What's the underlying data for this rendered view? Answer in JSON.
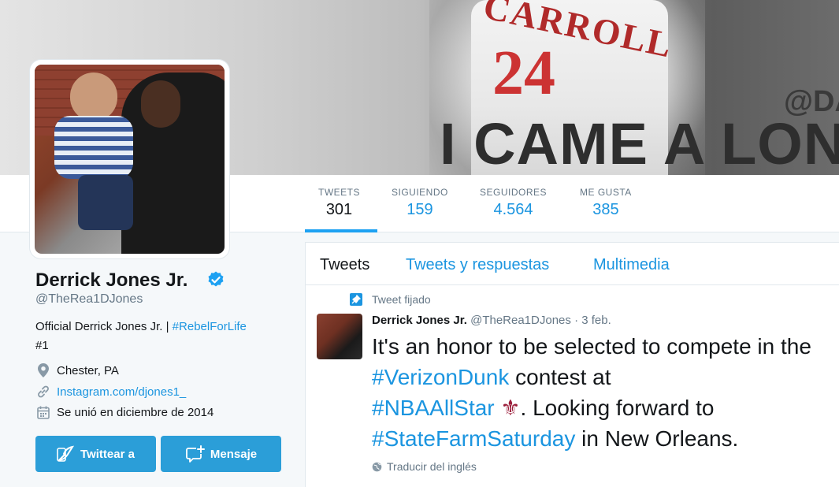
{
  "banner": {
    "team_text": "CARROLL",
    "number_text": "24",
    "handle_text": "@DA",
    "slogan_text": "I CAME A LONG"
  },
  "stats": [
    {
      "label": "TWEETS",
      "value": "301"
    },
    {
      "label": "SIGUIENDO",
      "value": "159"
    },
    {
      "label": "SEGUIDORES",
      "value": "4.564"
    },
    {
      "label": "ME GUSTA",
      "value": "385"
    }
  ],
  "profile": {
    "name": "Derrick Jones Jr.",
    "handle": "@TheRea1DJones",
    "bio_prefix": "Official Derrick Jones Jr. | ",
    "bio_hashtag": "#RebelForLife",
    "bio_suffix": "#1",
    "location": "Chester, PA",
    "website": "Instagram.com/djones1_",
    "joined": "Se unió en diciembre de 2014"
  },
  "buttons": {
    "tweet_to": "Twittear a",
    "message": "Mensaje"
  },
  "timeline": {
    "tabs": [
      "Tweets",
      "Tweets y respuestas",
      "Multimedia"
    ],
    "pinned_label": "Tweet fijado",
    "tweet": {
      "author": "Derrick Jones Jr.",
      "handle": "@TheRea1DJones",
      "separator": "·",
      "date": "3 feb.",
      "text_1": "It's an honor to be selected to compete in the ",
      "hashtag_1": "#VerizonDunk",
      "text_2": " contest at ",
      "hashtag_2": "#NBAAllStar",
      "emoji": "⚜",
      "text_3": ". Looking forward to ",
      "hashtag_3": "#StateFarmSaturday",
      "text_4": " in New Orleans."
    },
    "translate_label": "Traducir del inglés"
  },
  "colors": {
    "accent": "#1b95e0",
    "button": "#2b9ed8",
    "fleur": "#9b1d3a"
  }
}
